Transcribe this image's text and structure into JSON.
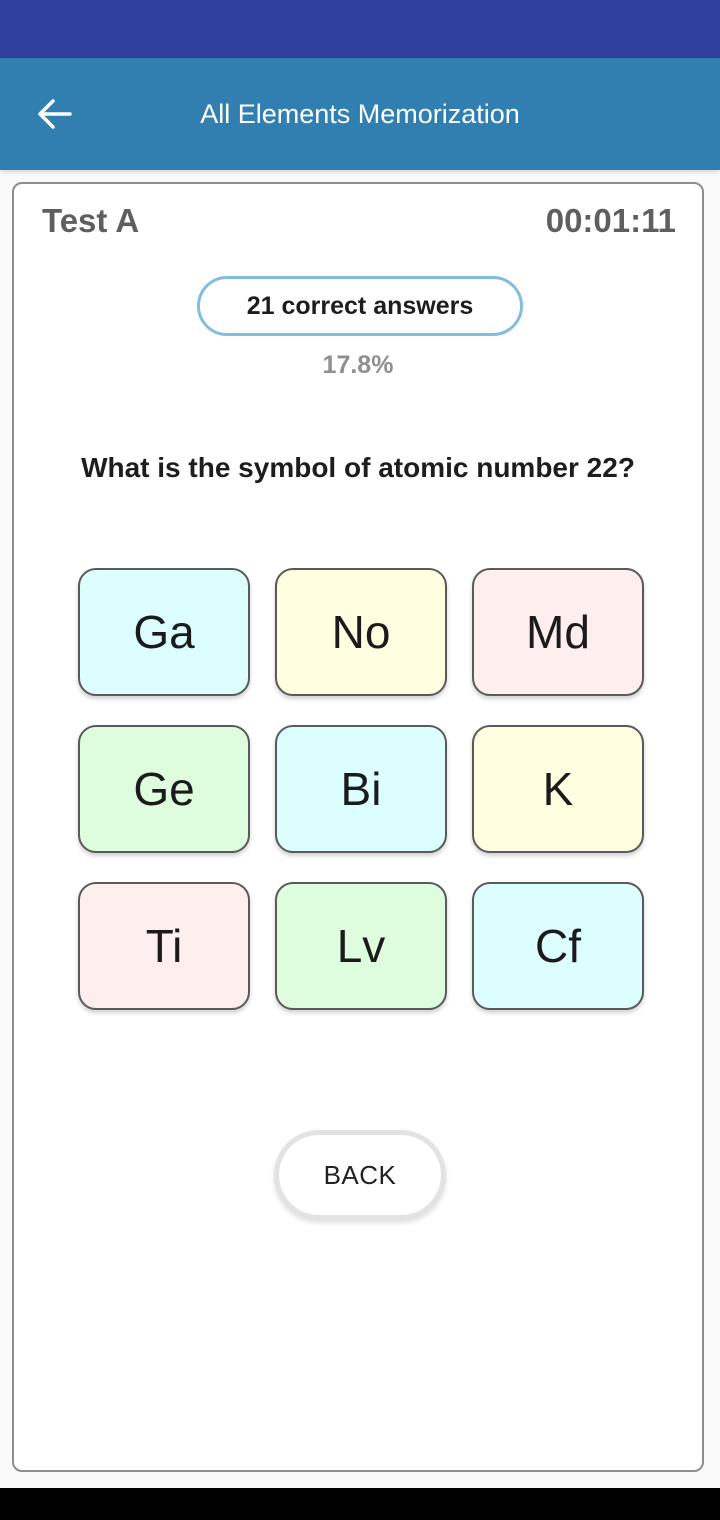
{
  "app": {
    "title": "All Elements Memorization",
    "back_icon": "arrow-left-icon"
  },
  "quiz": {
    "test_name": "Test A",
    "timer": "00:01:11",
    "score_label": "21 correct answers",
    "percent": "17.8%",
    "question": "What is the symbol of atomic number 22?",
    "options": [
      {
        "label": "Ga",
        "color": "#ddfeff"
      },
      {
        "label": "No",
        "color": "#fffee0"
      },
      {
        "label": "Md",
        "color": "#ffeeee"
      },
      {
        "label": "Ge",
        "color": "#defdde"
      },
      {
        "label": "Bi",
        "color": "#ddfeff"
      },
      {
        "label": "K",
        "color": "#fffee0"
      },
      {
        "label": "Ti",
        "color": "#ffeeee"
      },
      {
        "label": "Lv",
        "color": "#defdde"
      },
      {
        "label": "Cf",
        "color": "#ddfeff"
      }
    ],
    "back_button": "BACK"
  },
  "colors": {
    "status_bar": "#2f3f9e",
    "app_bar": "#307fb0",
    "pill_border": "#82bedc"
  }
}
